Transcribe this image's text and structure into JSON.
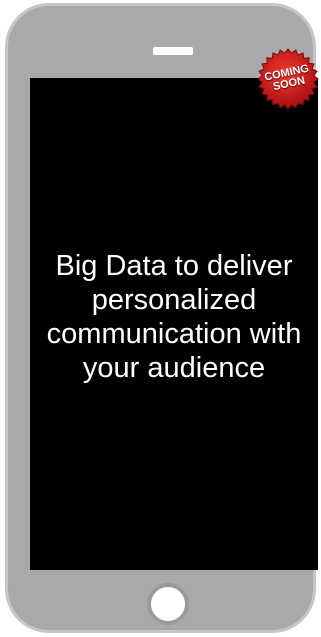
{
  "screen": {
    "headline": "Big Data to deliver personalized communication with your audience"
  },
  "badge": {
    "line1": "COMING",
    "line2": "SOON",
    "color": "#d0141a"
  },
  "colors": {
    "phone_body": "#a9a9a9",
    "screen": "#000000"
  },
  "icons": {
    "speaker": "speaker-slot-icon",
    "home": "home-button-icon"
  }
}
